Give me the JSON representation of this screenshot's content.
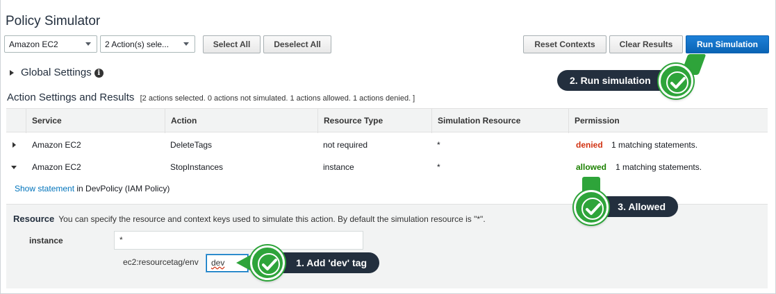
{
  "page": {
    "title": "Policy Simulator"
  },
  "toolbar": {
    "service_select": "Amazon EC2",
    "actions_select": "2 Action(s) sele...",
    "select_all": "Select All",
    "deselect_all": "Deselect All",
    "reset_contexts": "Reset Contexts",
    "clear_results": "Clear Results",
    "run_simulation": "Run Simulation"
  },
  "global_settings": {
    "label": "Global Settings",
    "info_glyph": "i"
  },
  "results": {
    "title": "Action Settings and Results",
    "summary": "[2 actions selected. 0 actions not simulated. 1 actions allowed. 1 actions denied. ]",
    "columns": [
      "Service",
      "Action",
      "Resource Type",
      "Simulation Resource",
      "Permission"
    ],
    "rows": [
      {
        "service": "Amazon EC2",
        "action": "DeleteTags",
        "resource_type": "not required",
        "sim_resource": "*",
        "permission": "denied",
        "matching": "1 matching statements."
      },
      {
        "service": "Amazon EC2",
        "action": "StopInstances",
        "resource_type": "instance",
        "sim_resource": "*",
        "permission": "allowed",
        "matching": "1 matching statements."
      }
    ],
    "show_statement_link": "Show statement",
    "show_statement_suffix": " in DevPolicy (IAM Policy)"
  },
  "resource": {
    "heading": "Resource",
    "description": "You can specify the resource and context keys used to simulate this action. By default the simulation resource is \"*\".",
    "instance_label": "instance",
    "instance_value": "*",
    "tag_key_label": "ec2:resourcetag/env",
    "tag_value": "dev"
  },
  "annotations": {
    "step1": "1. Add 'dev' tag",
    "step2": "2. Run simulation",
    "step3": "3. Allowed"
  },
  "colors": {
    "primary": "#0972d3",
    "denied": "#d13212",
    "allowed": "#1d8102",
    "badge": "#2ea43a",
    "callout": "#232f3e"
  }
}
